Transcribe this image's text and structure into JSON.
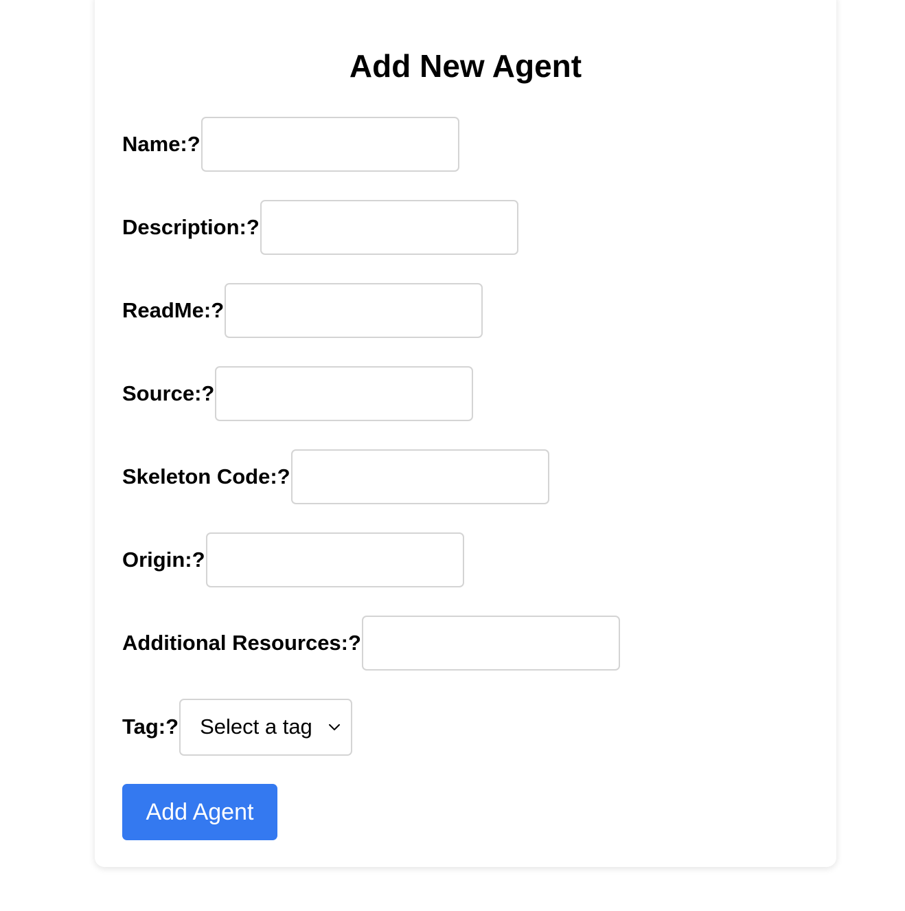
{
  "form": {
    "title": "Add New Agent",
    "fields": [
      {
        "label": "Name:?",
        "value": "",
        "placeholder": ""
      },
      {
        "label": "Description:?",
        "value": "",
        "placeholder": ""
      },
      {
        "label": "ReadMe:?",
        "value": "",
        "placeholder": ""
      },
      {
        "label": "Source:?",
        "value": "",
        "placeholder": ""
      },
      {
        "label": "Skeleton Code:?",
        "value": "",
        "placeholder": ""
      },
      {
        "label": "Origin:?",
        "value": "",
        "placeholder": ""
      },
      {
        "label": "Additional Resources:?",
        "value": "",
        "placeholder": ""
      }
    ],
    "tag": {
      "label": "Tag:?",
      "selected": "Select a tag",
      "icon": "chevron-down-icon"
    },
    "submit_label": "Add Agent"
  },
  "colors": {
    "accent": "#3479f0",
    "input_border": "#d4d4d4",
    "text": "#000000",
    "background": "#ffffff"
  }
}
